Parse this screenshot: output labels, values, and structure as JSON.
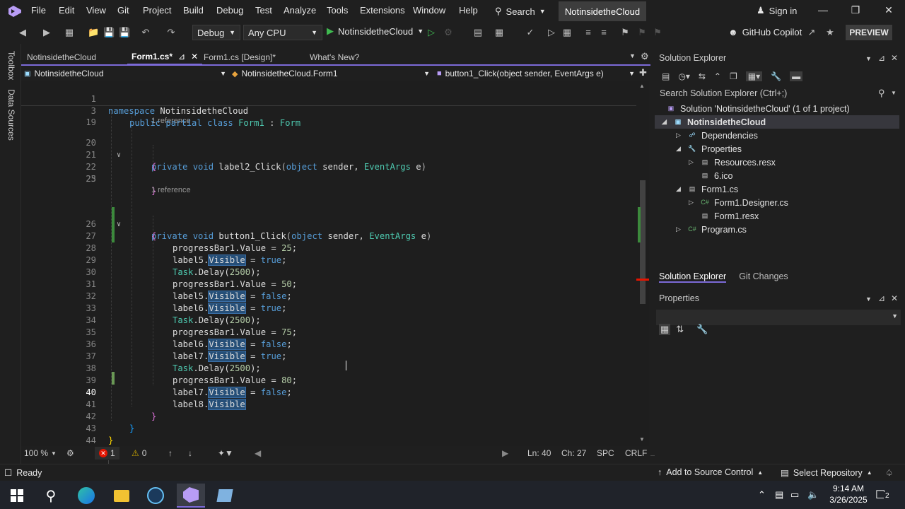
{
  "menu": {
    "items": [
      "File",
      "Edit",
      "View",
      "Git",
      "Project",
      "Build",
      "Debug",
      "Test",
      "Analyze",
      "Tools",
      "Extensions",
      "Window",
      "Help"
    ],
    "search_label": "Search",
    "solution_title": "NotinsidetheCloud",
    "sign_in": "Sign in"
  },
  "toolbar": {
    "config": "Debug",
    "platform": "Any CPU",
    "run_target": "NotinsidetheCloud",
    "copilot": "GitHub Copilot",
    "preview": "PREVIEW"
  },
  "left_rail": {
    "toolbox": "Toolbox",
    "data_sources": "Data Sources"
  },
  "doc_tabs": [
    {
      "label": "NotinsidetheCloud",
      "active": false
    },
    {
      "label": "Form1.cs*",
      "active": true
    },
    {
      "label": "Form1.cs [Design]*",
      "active": false
    },
    {
      "label": "What's New?",
      "active": false
    }
  ],
  "nav": {
    "project": "NotinsidetheCloud",
    "class": "NotinsidetheCloud.Form1",
    "member": "button1_Click(object sender, EventArgs e)"
  },
  "sticky": [
    {
      "num": "1",
      "text": "namespace NotinsidetheCloud"
    },
    {
      "num": "3",
      "text": "public partial class Form1 : Form"
    }
  ],
  "code": {
    "ref_label": "1 reference",
    "lines": {
      "l19": "19",
      "l20": "20",
      "l21": "21",
      "l22": "22",
      "l23": "23",
      "l25": "25",
      "l26": "26",
      "l27": "27",
      "l28": "28",
      "l29": "29",
      "l30": "30",
      "l31": "31",
      "l32": "32",
      "l33": "33",
      "l34": "34",
      "l35": "35",
      "l36": "36",
      "l37": "37",
      "l38": "38",
      "l39": "39",
      "l40": "40",
      "l41": "41",
      "l42": "42",
      "l43": "43",
      "l44": "44"
    },
    "method1_name": "label2_Click",
    "method2_name": "button1_Click",
    "progress_values": [
      "25",
      "50",
      "75",
      "80"
    ],
    "delay": "2500"
  },
  "editor_status": {
    "zoom": "100 %",
    "errors": "1",
    "warnings": "0",
    "line": "Ln: 40",
    "col": "Ch: 27",
    "spacing": "SPC",
    "eol": "CRLF"
  },
  "solution_explorer": {
    "title": "Solution Explorer",
    "search_placeholder": "Search Solution Explorer (Ctrl+;)",
    "items": [
      {
        "label": "Solution 'NotinsidetheCloud' (1 of 1 project)"
      },
      {
        "label": "NotinsidetheCloud"
      },
      {
        "label": "Dependencies"
      },
      {
        "label": "Properties"
      },
      {
        "label": "Resources.resx"
      },
      {
        "label": "6.ico"
      },
      {
        "label": "Form1.cs"
      },
      {
        "label": "Form1.Designer.cs"
      },
      {
        "label": "Form1.resx"
      },
      {
        "label": "Program.cs"
      }
    ],
    "tabs": [
      "Solution Explorer",
      "Git Changes"
    ]
  },
  "properties": {
    "title": "Properties"
  },
  "status_bar": {
    "ready": "Ready",
    "add_source": "Add to Source Control",
    "select_repo": "Select Repository"
  },
  "taskbar": {
    "time": "9:14 AM",
    "date": "3/26/2025",
    "notifications": "2"
  },
  "colors": {
    "accent": "#7c6ad8",
    "keyword": "#569cd6",
    "type": "#4ec9b0",
    "number": "#b5cea8",
    "error": "#e51400"
  }
}
